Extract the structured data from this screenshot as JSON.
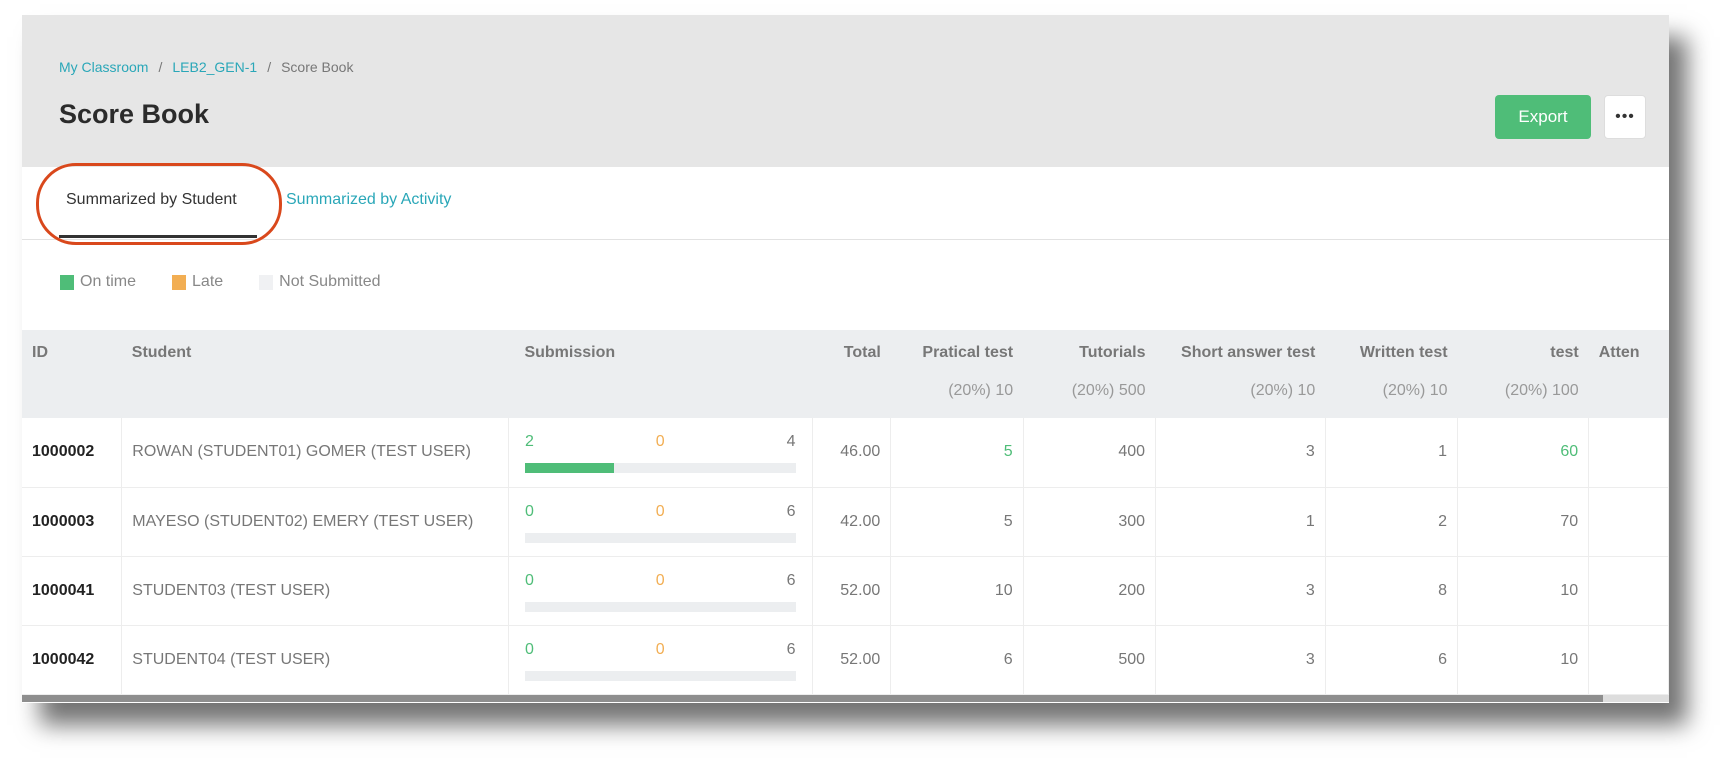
{
  "breadcrumb": [
    "My Classroom",
    "LEB2_GEN-1",
    "Score Book"
  ],
  "breadcrumb_sep": "/",
  "title": "Score Book",
  "export_label": "Export",
  "more_label": "•••",
  "tabs": [
    {
      "label": "Summarized by Student",
      "active": true
    },
    {
      "label": "Summarized by Activity",
      "active": false
    }
  ],
  "legend": [
    {
      "label": "On time",
      "color": "#4fbd78"
    },
    {
      "label": "Late",
      "color": "#f2ae53"
    },
    {
      "label": "Not Submitted",
      "color": "#f0f1f3"
    }
  ],
  "columns": {
    "id": "ID",
    "student": "Student",
    "submission": "Submission",
    "total": "Total",
    "activities": [
      {
        "name": "Pratical test",
        "weight": "(20%) 10"
      },
      {
        "name": "Tutorials",
        "weight": "(20%) 500"
      },
      {
        "name": "Short answer test",
        "weight": "(20%) 10"
      },
      {
        "name": "Written test",
        "weight": "(20%) 10"
      },
      {
        "name": "test",
        "weight": "(20%) 100"
      },
      {
        "name": "Atten",
        "weight": ""
      }
    ]
  },
  "rows": [
    {
      "id": "1000002",
      "student": "ROWAN (STUDENT01) GOMER (TEST USER)",
      "on_time": "2",
      "late": "0",
      "not_submitted": "4",
      "on_time_fraction": 0.33,
      "total": "46.00",
      "scores": [
        "5",
        "400",
        "3",
        "1",
        "60",
        ""
      ],
      "green": [
        true,
        false,
        false,
        false,
        true,
        false
      ]
    },
    {
      "id": "1000003",
      "student": "MAYESO (STUDENT02) EMERY (TEST USER)",
      "on_time": "0",
      "late": "0",
      "not_submitted": "6",
      "on_time_fraction": 0,
      "total": "42.00",
      "scores": [
        "5",
        "300",
        "1",
        "2",
        "70",
        ""
      ],
      "green": [
        false,
        false,
        false,
        false,
        false,
        false
      ]
    },
    {
      "id": "1000041",
      "student": "STUDENT03 (TEST USER)",
      "on_time": "0",
      "late": "0",
      "not_submitted": "6",
      "on_time_fraction": 0,
      "total": "52.00",
      "scores": [
        "10",
        "200",
        "3",
        "8",
        "10",
        ""
      ],
      "green": [
        false,
        false,
        false,
        false,
        false,
        false
      ]
    },
    {
      "id": "1000042",
      "student": "STUDENT04 (TEST USER)",
      "on_time": "0",
      "late": "0",
      "not_submitted": "6",
      "on_time_fraction": 0,
      "total": "52.00",
      "scores": [
        "6",
        "500",
        "3",
        "6",
        "10",
        ""
      ],
      "green": [
        false,
        false,
        false,
        false,
        false,
        false
      ]
    }
  ],
  "scroll_position_fraction": 0.96
}
